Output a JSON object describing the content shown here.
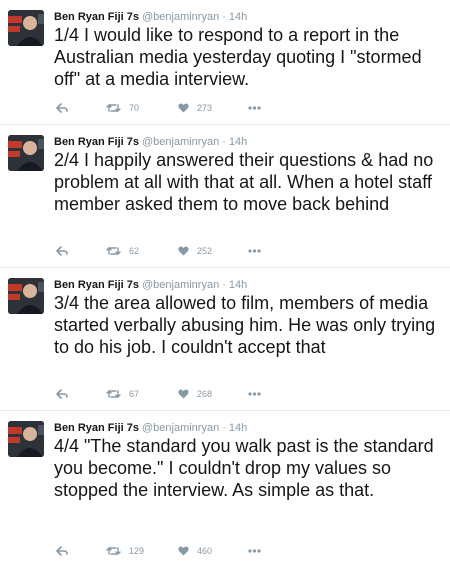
{
  "tweets": [
    {
      "name": "Ben Ryan Fiji 7s",
      "handle": "@benjaminryan",
      "time": "14h",
      "text": "1/4 I would like to respond to a report in the Australian media yesterday quoting I \"stormed off\" at a media interview.",
      "retweets": "70",
      "likes": "273"
    },
    {
      "name": "Ben Ryan Fiji 7s",
      "handle": "@benjaminryan",
      "time": "14h",
      "text": "2/4 I happily answered their questions & had no problem at all with that at all. When a hotel staff member asked them to move back behind",
      "retweets": "62",
      "likes": "252"
    },
    {
      "name": "Ben Ryan Fiji 7s",
      "handle": "@benjaminryan",
      "time": "14h",
      "text": "3/4 the area allowed to film, members of media started verbally abusing him. He was only trying to do his job. I couldn't accept that",
      "retweets": "67",
      "likes": "268"
    },
    {
      "name": "Ben Ryan Fiji 7s",
      "handle": "@benjaminryan",
      "time": "14h",
      "text": "4/4 \"The standard you walk past is the standard you become.\" I couldn't drop my values so stopped the interview. As simple as that.",
      "retweets": "129",
      "likes": "460"
    }
  ],
  "separator": "·",
  "icons": {
    "reply": "reply-icon",
    "retweet": "retweet-icon",
    "like": "heart-icon",
    "more": "more-icon"
  },
  "colors": {
    "text": "#14171a",
    "muted": "#8899a6",
    "border": "#e6ecf0"
  }
}
